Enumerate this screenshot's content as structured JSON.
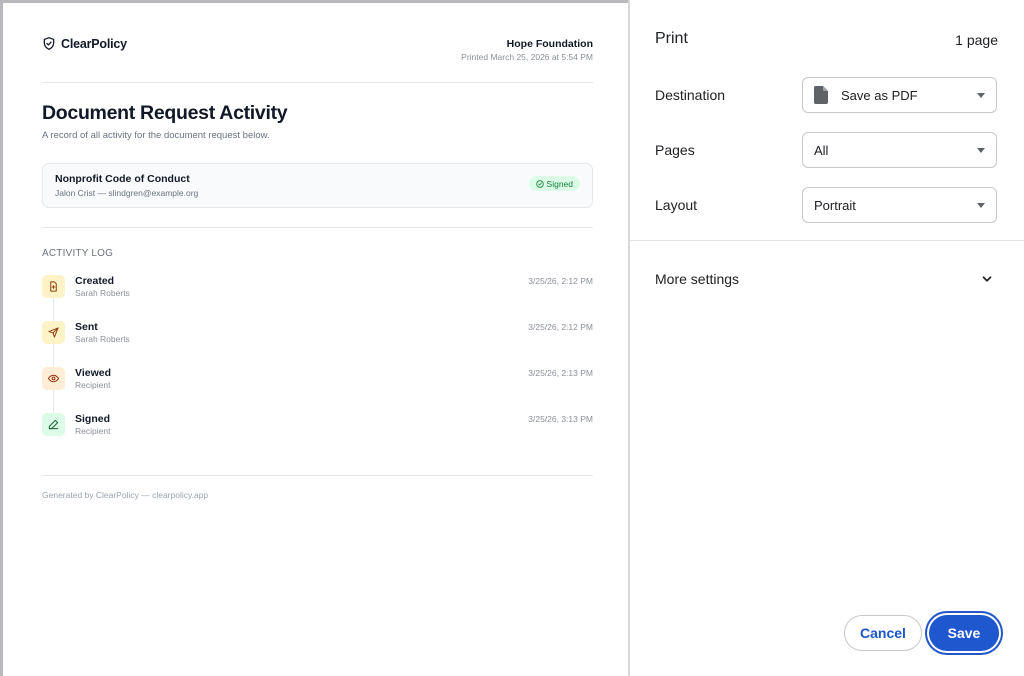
{
  "preview": {
    "brand": "ClearPolicy",
    "org_name": "Hope Foundation",
    "printed": "Printed March 25, 2026 at 5:54 PM",
    "title": "Document Request Activity",
    "subtitle": "A record of all activity for the document request below.",
    "request": {
      "title": "Nonprofit Code of Conduct",
      "meta": "Jalon Crist — slindgren@example.org",
      "status": "Signed",
      "status_color": "#15803d"
    },
    "log_heading": "ACTIVITY LOG",
    "activities": [
      {
        "name": "Created",
        "by": "Sarah Roberts",
        "time": "3/25/26, 2:12 PM",
        "icon": "file-plus-icon",
        "color": "#fef3c7"
      },
      {
        "name": "Sent",
        "by": "Sarah Roberts",
        "time": "3/25/26, 2:12 PM",
        "icon": "send-icon",
        "color": "#fef3c7"
      },
      {
        "name": "Viewed",
        "by": "Recipient",
        "time": "3/25/26, 2:13 PM",
        "icon": "eye-icon",
        "color": "#ffedd5"
      },
      {
        "name": "Signed",
        "by": "Recipient",
        "time": "3/25/26, 3:13 PM",
        "icon": "pen-icon",
        "color": "#dcfce7"
      }
    ],
    "footer": "Generated by ClearPolicy — clearpolicy.app"
  },
  "print": {
    "title": "Print",
    "page_count": "1 page",
    "destination": {
      "label": "Destination",
      "value": "Save as PDF"
    },
    "pages": {
      "label": "Pages",
      "value": "All"
    },
    "layout": {
      "label": "Layout",
      "value": "Portrait"
    },
    "more_settings": "More settings",
    "cancel": "Cancel",
    "save": "Save",
    "accent": "#1f57cf"
  }
}
